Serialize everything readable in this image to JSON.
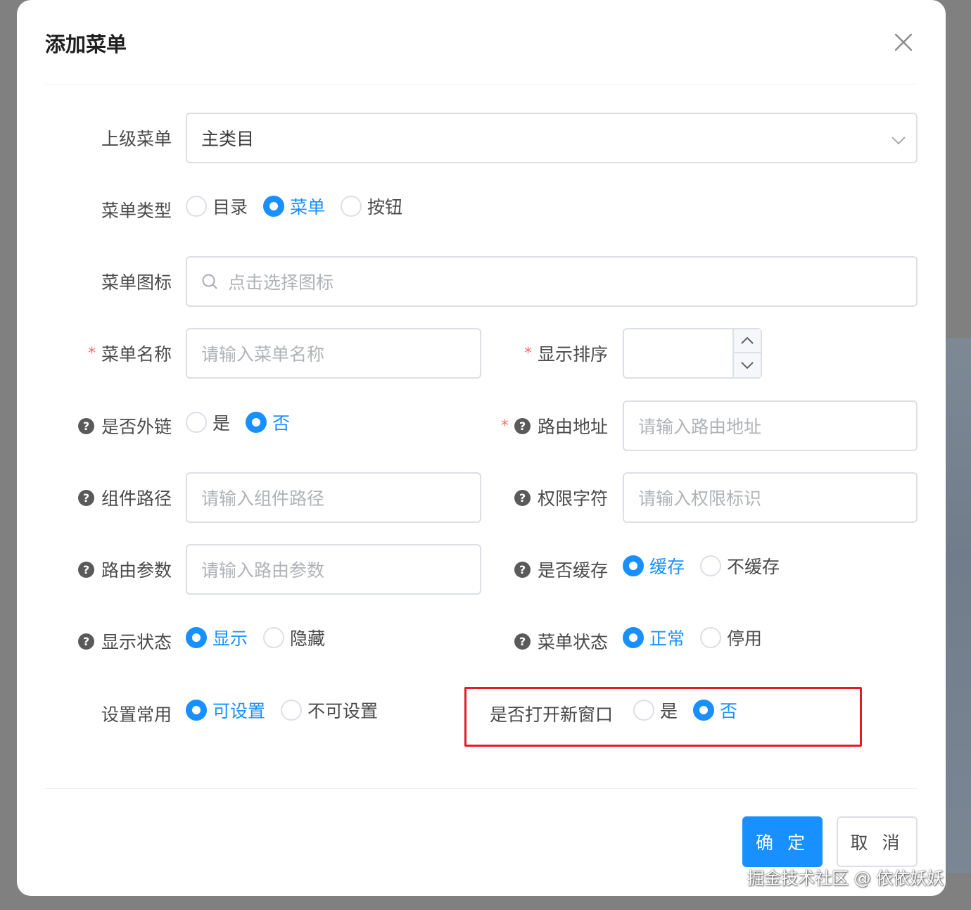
{
  "dialog": {
    "title": "添加菜单",
    "close_icon": "close-icon"
  },
  "parent_menu": {
    "label": "上级菜单",
    "value": "主类目"
  },
  "menu_type": {
    "label": "菜单类型",
    "options": [
      "目录",
      "菜单",
      "按钮"
    ],
    "selected": "菜单"
  },
  "menu_icon": {
    "label": "菜单图标",
    "placeholder": "点击选择图标"
  },
  "menu_name": {
    "label": "菜单名称",
    "placeholder": "请输入菜单名称",
    "required": "*"
  },
  "sort_order": {
    "label": "显示排序",
    "required": "*"
  },
  "is_external": {
    "label": "是否外链",
    "options": [
      "是",
      "否"
    ],
    "selected": "否"
  },
  "route_path": {
    "label": "路由地址",
    "placeholder": "请输入路由地址",
    "required": "*"
  },
  "component_path": {
    "label": "组件路径",
    "placeholder": "请输入组件路径"
  },
  "permission": {
    "label": "权限字符",
    "placeholder": "请输入权限标识"
  },
  "route_params": {
    "label": "路由参数",
    "placeholder": "请输入路由参数"
  },
  "is_cache": {
    "label": "是否缓存",
    "options": [
      "缓存",
      "不缓存"
    ],
    "selected": "缓存"
  },
  "visible": {
    "label": "显示状态",
    "options": [
      "显示",
      "隐藏"
    ],
    "selected": "显示"
  },
  "status": {
    "label": "菜单状态",
    "options": [
      "正常",
      "停用"
    ],
    "selected": "正常"
  },
  "common": {
    "label": "设置常用",
    "options": [
      "可设置",
      "不可设置"
    ],
    "selected": "可设置"
  },
  "new_window": {
    "label": "是否打开新窗口",
    "options": [
      "是",
      "否"
    ],
    "selected": "否"
  },
  "footer": {
    "confirm": "确 定",
    "cancel": "取 消"
  },
  "help_glyph": "?",
  "watermark": "掘金技术社区 @ 依依妖妖",
  "colors": {
    "primary": "#1890ff",
    "required": "#f56c6c",
    "highlight_border": "#e51c23"
  }
}
